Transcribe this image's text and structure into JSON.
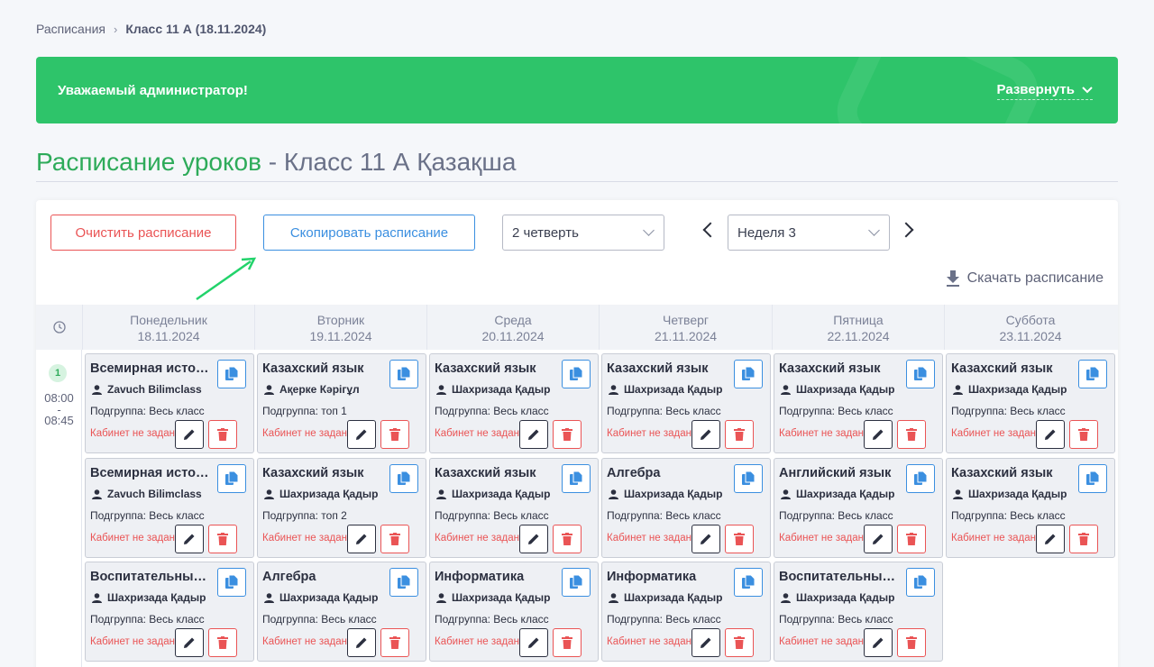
{
  "breadcrumb": {
    "root": "Расписания",
    "current": "Класс 11 А (18.11.2024)"
  },
  "banner": {
    "title": "Уважаемый администратор!",
    "expand_label": "Развернуть"
  },
  "page_title": {
    "main": "Расписание уроков",
    "dash": " - ",
    "class": "Класс 11 А Қазақша"
  },
  "toolbar": {
    "clear_label": "Очистить расписание",
    "copy_label": "Скопировать расписание",
    "quarter": "2 четверть",
    "week": "Неделя 3",
    "download_label": "Скачать расписание"
  },
  "days": [
    {
      "name": "Понедельник",
      "date": "18.11.2024"
    },
    {
      "name": "Вторник",
      "date": "19.11.2024"
    },
    {
      "name": "Среда",
      "date": "20.11.2024"
    },
    {
      "name": "Четверг",
      "date": "21.11.2024"
    },
    {
      "name": "Пятница",
      "date": "22.11.2024"
    },
    {
      "name": "Суббота",
      "date": "23.11.2024"
    }
  ],
  "slot": {
    "number": "1",
    "start": "08:00",
    "dash": "-",
    "end": "08:45"
  },
  "subgroup_prefix": "Подгруппа: ",
  "no_cabinet": "Кабинет не задан",
  "lessons": [
    [
      {
        "subject": "Всемирная история",
        "teacher": "Zavuch Bilimclass",
        "subgroup": "Весь класс"
      },
      {
        "subject": "Всемирная история",
        "teacher": "Zavuch Bilimclass",
        "subgroup": "Весь класс"
      },
      {
        "subject": "Воспитательный час",
        "teacher": "Шахризада Қадыр",
        "subgroup": "Весь класс"
      }
    ],
    [
      {
        "subject": "Казахский язык",
        "teacher": "Ақерке Кәрігұл",
        "subgroup": "топ 1"
      },
      {
        "subject": "Казахский язык",
        "teacher": "Шахризада Қадыр",
        "subgroup": "топ 2"
      },
      {
        "subject": "Алгебра",
        "teacher": "Шахризада Қадыр",
        "subgroup": "Весь класс"
      }
    ],
    [
      {
        "subject": "Казахский язык",
        "teacher": "Шахризада Қадыр",
        "subgroup": "Весь класс"
      },
      {
        "subject": "Казахский язык",
        "teacher": "Шахризада Қадыр",
        "subgroup": "Весь класс"
      },
      {
        "subject": "Информатика",
        "teacher": "Шахризада Қадыр",
        "subgroup": "Весь класс"
      }
    ],
    [
      {
        "subject": "Казахский язык",
        "teacher": "Шахризада Қадыр",
        "subgroup": "Весь класс"
      },
      {
        "subject": "Алгебра",
        "teacher": "Шахризада Қадыр",
        "subgroup": "Весь класс"
      },
      {
        "subject": "Информатика",
        "teacher": "Шахризада Қадыр",
        "subgroup": "Весь класс"
      }
    ],
    [
      {
        "subject": "Казахский язык",
        "teacher": "Шахризада Қадыр",
        "subgroup": "Весь класс"
      },
      {
        "subject": "Английский язык",
        "teacher": "Шахризада Қадыр",
        "subgroup": "Весь класс"
      },
      {
        "subject": "Воспитательный час",
        "teacher": "Шахризада Қадыр",
        "subgroup": "Весь класс"
      }
    ],
    [
      {
        "subject": "Казахский язык",
        "teacher": "Шахризада Қадыр",
        "subgroup": "Весь класс"
      },
      {
        "subject": "Казахский язык",
        "teacher": "Шахризада Қадыр",
        "subgroup": "Весь класс"
      }
    ]
  ],
  "colors": {
    "accent_green": "#2ec46a",
    "title_green": "#2eab5a",
    "danger": "#ea5455",
    "primary": "#3b8fe0"
  }
}
